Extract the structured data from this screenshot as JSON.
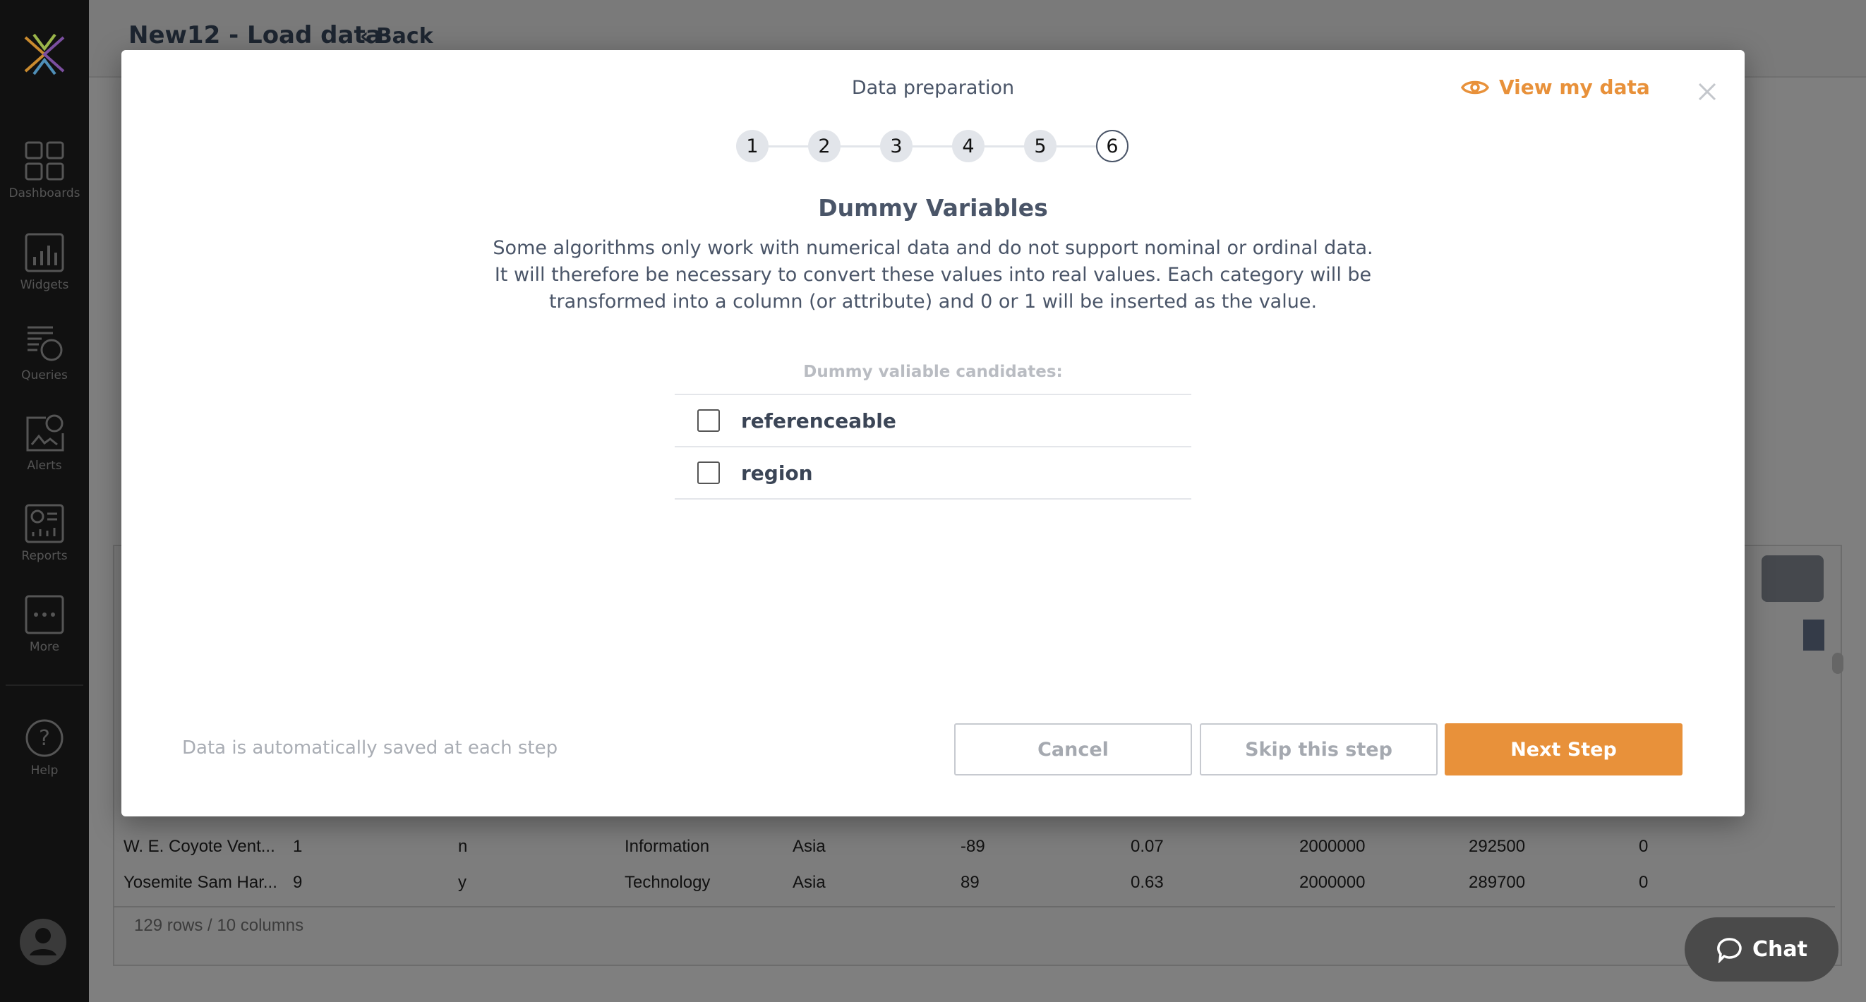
{
  "page": {
    "title": "New12 - Load data",
    "back_label": "Back"
  },
  "sidebar": {
    "items": [
      {
        "label": "Dashboards",
        "icon": "dashboards-icon"
      },
      {
        "label": "Widgets",
        "icon": "widgets-icon"
      },
      {
        "label": "Queries",
        "icon": "queries-icon"
      },
      {
        "label": "Alerts",
        "icon": "alerts-icon"
      },
      {
        "label": "Reports",
        "icon": "reports-icon"
      },
      {
        "label": "More",
        "icon": "more-icon"
      }
    ],
    "help_label": "Help"
  },
  "table": {
    "rows": [
      [
        "W. E. Coyote Vent...",
        "1",
        "n",
        "Information",
        "Asia",
        "-89",
        "0.07",
        "2000000",
        "292500",
        "0"
      ],
      [
        "Yosemite Sam Har...",
        "9",
        "y",
        "Technology",
        "Asia",
        "89",
        "0.63",
        "2000000",
        "289700",
        "0"
      ]
    ],
    "footer": "129 rows / 10 columns"
  },
  "chat": {
    "label": "Chat"
  },
  "modal": {
    "title": "Data preparation",
    "view_data_label": "View my data",
    "steps": [
      "1",
      "2",
      "3",
      "4",
      "5",
      "6"
    ],
    "active_step": 6,
    "heading": "Dummy Variables",
    "description": "Some algorithms only work with numerical data and do not support nominal or ordinal data. It will therefore be necessary to convert these values into real values. Each category will be transformed into a column (or attribute) and 0 or 1 will be inserted as the value.",
    "candidates_label": "Dummy valiable candidates:",
    "candidates": [
      {
        "label": "referenceable",
        "checked": false
      },
      {
        "label": "region",
        "checked": false
      }
    ],
    "autosave_note": "Data is automatically saved at each step",
    "buttons": {
      "cancel": "Cancel",
      "skip": "Skip this step",
      "next": "Next Step"
    }
  },
  "colors": {
    "accent": "#e8913a",
    "text": "#4a5568",
    "sidebar": "#111111"
  }
}
